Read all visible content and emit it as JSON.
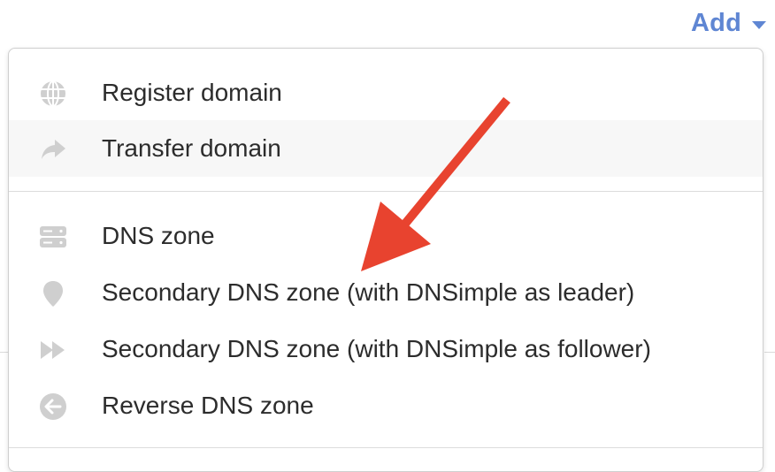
{
  "add_button": {
    "label": "Add"
  },
  "menu": {
    "group1": [
      {
        "label": "Register domain",
        "icon": "globe-icon"
      },
      {
        "label": "Transfer domain",
        "icon": "share-arrow-icon"
      }
    ],
    "group2": [
      {
        "label": "DNS zone",
        "icon": "server-icon"
      },
      {
        "label": "Secondary DNS zone (with DNSimple as leader)",
        "icon": "map-pin-icon"
      },
      {
        "label": "Secondary DNS zone (with DNSimple as follower)",
        "icon": "fast-forward-icon"
      },
      {
        "label": "Reverse DNS zone",
        "icon": "circle-arrow-left-icon"
      }
    ]
  },
  "colors": {
    "accent": "#5f86d3",
    "annotation_arrow": "#e8432f",
    "icon_gray": "#cfcfcf",
    "text": "#2c2c2c"
  }
}
